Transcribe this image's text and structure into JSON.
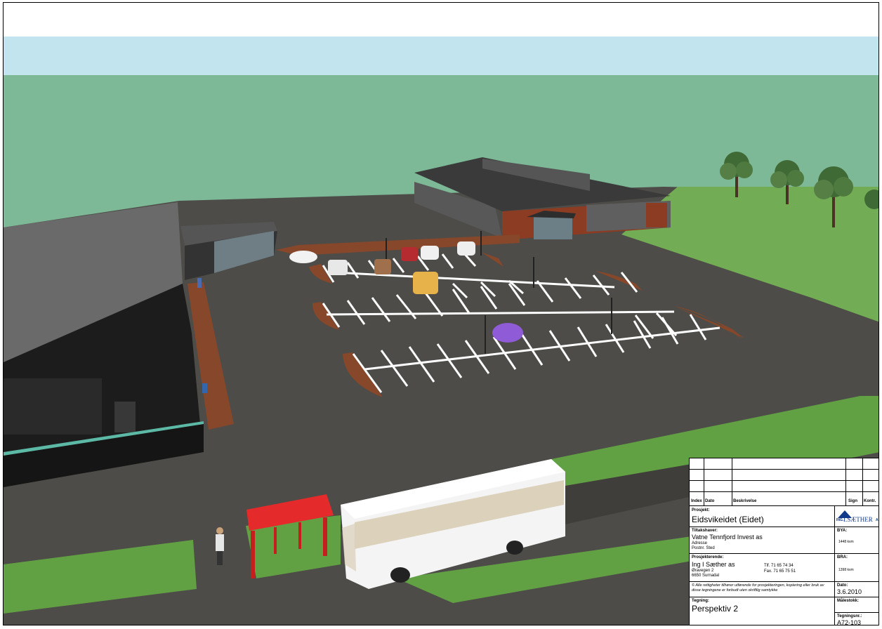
{
  "revision_header": {
    "index": "Index",
    "date": "Dato",
    "description": "Beskrivelse",
    "sign": "Sign",
    "control": "Kontr."
  },
  "project": {
    "label": "Prosjekt:",
    "name": "Eidsvikeidet (Eidet)"
  },
  "client": {
    "label": "Tiltakshaver:",
    "name": "Vatne Tennfjord Invest as",
    "address": "Adresse",
    "postal": "Postnr. Sted"
  },
  "designer": {
    "label": "Prosjekterende:",
    "name": "Ing I Sæther as",
    "street": "Øravegen 2",
    "city": "6650 Surnadal",
    "phone": "Tlf. 71 65 74 34",
    "fax": "Fax. 71 65 75 51"
  },
  "copyright": "© Alle rettigheter tilhører utførende for prosjekteringen, kopiering eller bruk av disse tegningene er forbudt uten skriftlig samtykke",
  "logo": {
    "prefix": "ING.",
    "name": "I.SÆTHER",
    "suffix": "AS"
  },
  "bya": {
    "label": "BYA:",
    "value": "1448 kvm"
  },
  "bra": {
    "label": "BRA:",
    "value": "1398 kvm"
  },
  "date": {
    "label": "Dato:",
    "value": "3.6.2010"
  },
  "scale": {
    "label": "Målestokk:"
  },
  "drawing": {
    "label": "Tegning:",
    "name": "Perspektiv 2"
  },
  "drawing_no": {
    "label": "Tegningsnr.:",
    "value": "A72-103"
  },
  "colors": {
    "sky": "#c2e4ee",
    "land": "#7db897",
    "asphalt": "#4d4c48",
    "grass": "#62a044",
    "building_wall": "#1c1c1c",
    "building_roof": "#6a6a6a",
    "timber": "#8b3c22",
    "mulch": "#86472a",
    "bus_shelter": "#e42a2a",
    "bus": "#f4f4f4"
  }
}
